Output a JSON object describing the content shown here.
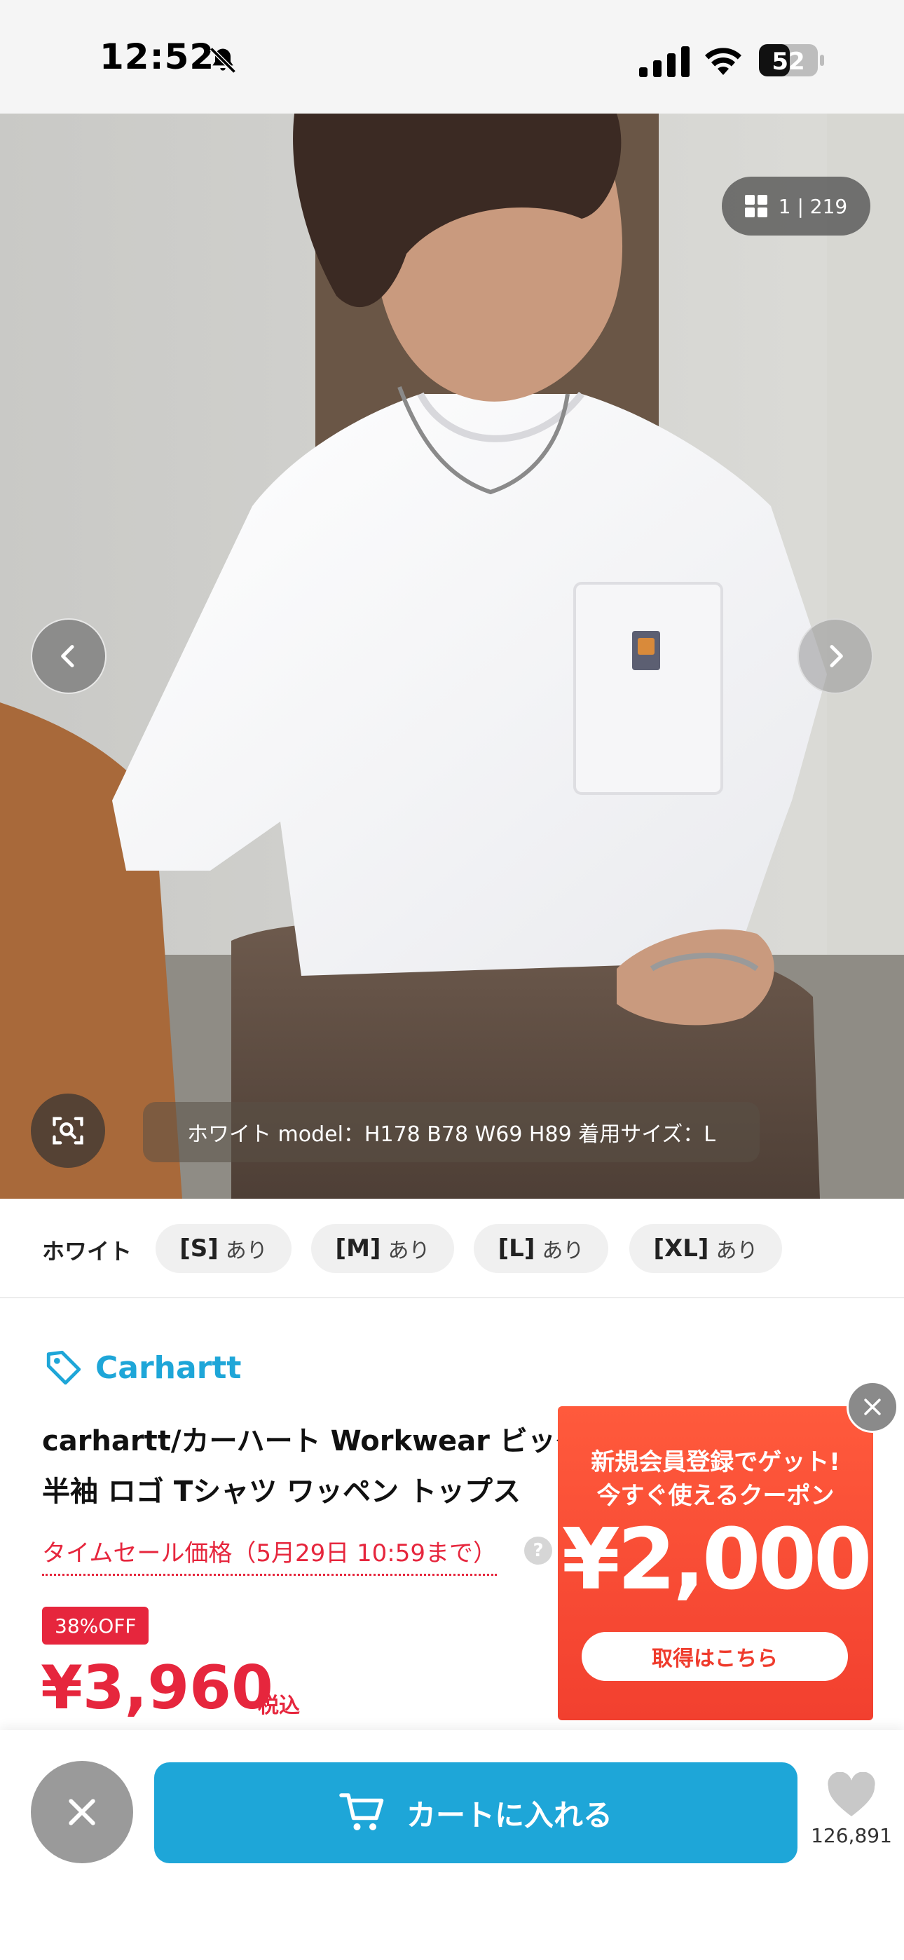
{
  "status_bar": {
    "time": "12:52",
    "battery": "52",
    "icons": [
      "bell-slash-icon",
      "signal-icon",
      "wifi-icon",
      "battery-icon"
    ]
  },
  "gallery": {
    "counter": "1 | 219",
    "caption": "ホワイト model：H178 B78 W69 H89 着用サイズ：L",
    "icons": [
      "grid-icon",
      "chevron-left-icon",
      "chevron-right-icon",
      "visual-search-icon"
    ]
  },
  "sizes": {
    "color": "ホワイト",
    "items": [
      {
        "size": "[S]",
        "availability": "あり"
      },
      {
        "size": "[M]",
        "availability": "あり"
      },
      {
        "size": "[L]",
        "availability": "あり"
      },
      {
        "size": "[XL]",
        "availability": "あり"
      }
    ]
  },
  "product": {
    "brand": "Carhartt",
    "title_line1": "carhartt/カーハート Workwear ビッグ",
    "title_line2": "半袖 ロゴ Tシャツ ワッペン トップス",
    "sale_label": "タイムセール価格（5月29日 10:59まで）",
    "help": "?",
    "discount": "38%OFF",
    "price": "¥3,960",
    "tax_label": "税込"
  },
  "coupon": {
    "line1": "新規会員登録でゲット!",
    "line2": "今すぐ使えるクーポン",
    "amount": "¥2,000",
    "cta": "取得はこちら"
  },
  "bottom_bar": {
    "cart_label": "カートに入れる",
    "favorite_count": "126,891"
  },
  "colors": {
    "accent_blue": "#1ea6d8",
    "sale_red": "#e6263d",
    "coupon_orange": "#f2402f"
  }
}
